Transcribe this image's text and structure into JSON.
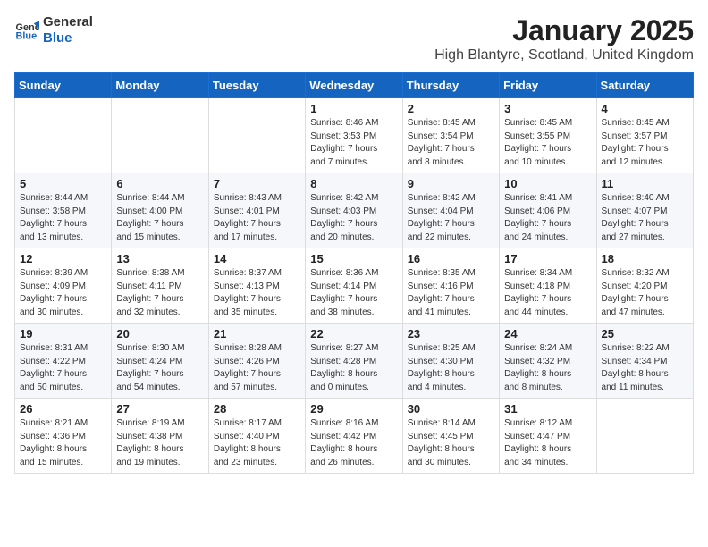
{
  "header": {
    "logo_general": "General",
    "logo_blue": "Blue",
    "month": "January 2025",
    "location": "High Blantyre, Scotland, United Kingdom"
  },
  "calendar": {
    "days_of_week": [
      "Sunday",
      "Monday",
      "Tuesday",
      "Wednesday",
      "Thursday",
      "Friday",
      "Saturday"
    ],
    "weeks": [
      [
        {
          "day": "",
          "details": ""
        },
        {
          "day": "",
          "details": ""
        },
        {
          "day": "",
          "details": ""
        },
        {
          "day": "1",
          "details": "Sunrise: 8:46 AM\nSunset: 3:53 PM\nDaylight: 7 hours\nand 7 minutes."
        },
        {
          "day": "2",
          "details": "Sunrise: 8:45 AM\nSunset: 3:54 PM\nDaylight: 7 hours\nand 8 minutes."
        },
        {
          "day": "3",
          "details": "Sunrise: 8:45 AM\nSunset: 3:55 PM\nDaylight: 7 hours\nand 10 minutes."
        },
        {
          "day": "4",
          "details": "Sunrise: 8:45 AM\nSunset: 3:57 PM\nDaylight: 7 hours\nand 12 minutes."
        }
      ],
      [
        {
          "day": "5",
          "details": "Sunrise: 8:44 AM\nSunset: 3:58 PM\nDaylight: 7 hours\nand 13 minutes."
        },
        {
          "day": "6",
          "details": "Sunrise: 8:44 AM\nSunset: 4:00 PM\nDaylight: 7 hours\nand 15 minutes."
        },
        {
          "day": "7",
          "details": "Sunrise: 8:43 AM\nSunset: 4:01 PM\nDaylight: 7 hours\nand 17 minutes."
        },
        {
          "day": "8",
          "details": "Sunrise: 8:42 AM\nSunset: 4:03 PM\nDaylight: 7 hours\nand 20 minutes."
        },
        {
          "day": "9",
          "details": "Sunrise: 8:42 AM\nSunset: 4:04 PM\nDaylight: 7 hours\nand 22 minutes."
        },
        {
          "day": "10",
          "details": "Sunrise: 8:41 AM\nSunset: 4:06 PM\nDaylight: 7 hours\nand 24 minutes."
        },
        {
          "day": "11",
          "details": "Sunrise: 8:40 AM\nSunset: 4:07 PM\nDaylight: 7 hours\nand 27 minutes."
        }
      ],
      [
        {
          "day": "12",
          "details": "Sunrise: 8:39 AM\nSunset: 4:09 PM\nDaylight: 7 hours\nand 30 minutes."
        },
        {
          "day": "13",
          "details": "Sunrise: 8:38 AM\nSunset: 4:11 PM\nDaylight: 7 hours\nand 32 minutes."
        },
        {
          "day": "14",
          "details": "Sunrise: 8:37 AM\nSunset: 4:13 PM\nDaylight: 7 hours\nand 35 minutes."
        },
        {
          "day": "15",
          "details": "Sunrise: 8:36 AM\nSunset: 4:14 PM\nDaylight: 7 hours\nand 38 minutes."
        },
        {
          "day": "16",
          "details": "Sunrise: 8:35 AM\nSunset: 4:16 PM\nDaylight: 7 hours\nand 41 minutes."
        },
        {
          "day": "17",
          "details": "Sunrise: 8:34 AM\nSunset: 4:18 PM\nDaylight: 7 hours\nand 44 minutes."
        },
        {
          "day": "18",
          "details": "Sunrise: 8:32 AM\nSunset: 4:20 PM\nDaylight: 7 hours\nand 47 minutes."
        }
      ],
      [
        {
          "day": "19",
          "details": "Sunrise: 8:31 AM\nSunset: 4:22 PM\nDaylight: 7 hours\nand 50 minutes."
        },
        {
          "day": "20",
          "details": "Sunrise: 8:30 AM\nSunset: 4:24 PM\nDaylight: 7 hours\nand 54 minutes."
        },
        {
          "day": "21",
          "details": "Sunrise: 8:28 AM\nSunset: 4:26 PM\nDaylight: 7 hours\nand 57 minutes."
        },
        {
          "day": "22",
          "details": "Sunrise: 8:27 AM\nSunset: 4:28 PM\nDaylight: 8 hours\nand 0 minutes."
        },
        {
          "day": "23",
          "details": "Sunrise: 8:25 AM\nSunset: 4:30 PM\nDaylight: 8 hours\nand 4 minutes."
        },
        {
          "day": "24",
          "details": "Sunrise: 8:24 AM\nSunset: 4:32 PM\nDaylight: 8 hours\nand 8 minutes."
        },
        {
          "day": "25",
          "details": "Sunrise: 8:22 AM\nSunset: 4:34 PM\nDaylight: 8 hours\nand 11 minutes."
        }
      ],
      [
        {
          "day": "26",
          "details": "Sunrise: 8:21 AM\nSunset: 4:36 PM\nDaylight: 8 hours\nand 15 minutes."
        },
        {
          "day": "27",
          "details": "Sunrise: 8:19 AM\nSunset: 4:38 PM\nDaylight: 8 hours\nand 19 minutes."
        },
        {
          "day": "28",
          "details": "Sunrise: 8:17 AM\nSunset: 4:40 PM\nDaylight: 8 hours\nand 23 minutes."
        },
        {
          "day": "29",
          "details": "Sunrise: 8:16 AM\nSunset: 4:42 PM\nDaylight: 8 hours\nand 26 minutes."
        },
        {
          "day": "30",
          "details": "Sunrise: 8:14 AM\nSunset: 4:45 PM\nDaylight: 8 hours\nand 30 minutes."
        },
        {
          "day": "31",
          "details": "Sunrise: 8:12 AM\nSunset: 4:47 PM\nDaylight: 8 hours\nand 34 minutes."
        },
        {
          "day": "",
          "details": ""
        }
      ]
    ]
  }
}
